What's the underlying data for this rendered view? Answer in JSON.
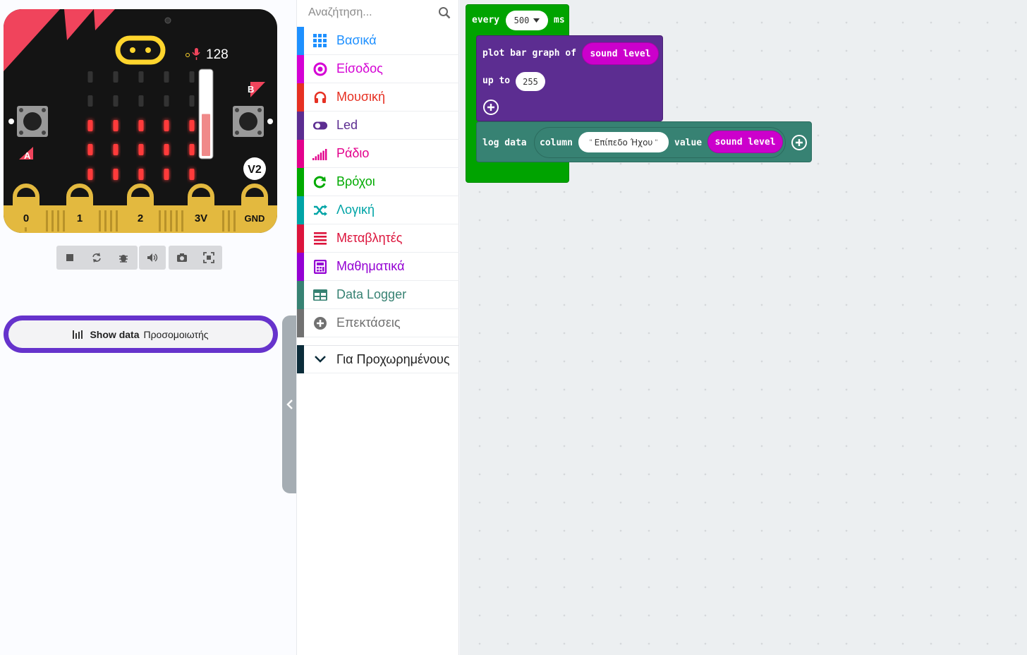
{
  "simulator": {
    "sound_value": "128",
    "sound_level_fraction": 0.5,
    "button_a": "A",
    "button_b": "B",
    "version_badge": "V2",
    "pins": [
      "0",
      "1",
      "2",
      "3V",
      "GND"
    ],
    "led_rows": [
      [
        0,
        0,
        0,
        0,
        0
      ],
      [
        0,
        0,
        0,
        0,
        0
      ],
      [
        1,
        1,
        1,
        1,
        1
      ],
      [
        1,
        1,
        1,
        1,
        1
      ],
      [
        1,
        1,
        1,
        1,
        1
      ]
    ],
    "toolbar": [
      "stop",
      "restart",
      "debug",
      "mute",
      "screenshot",
      "fullscreen"
    ]
  },
  "show_data": {
    "label_bold": "Show data",
    "label_rest": "Προσομοιωτής"
  },
  "toolbox": {
    "search_placeholder": "Αναζήτηση...",
    "categories": [
      {
        "label": "Βασικά",
        "color": "#1e90ff",
        "icon": "grid-icon"
      },
      {
        "label": "Είσοδος",
        "color": "#d400d4",
        "icon": "input-circle-icon"
      },
      {
        "label": "Μουσική",
        "color": "#e63022",
        "icon": "headphones-icon"
      },
      {
        "label": "Led",
        "color": "#5c2d91",
        "icon": "toggle-icon"
      },
      {
        "label": "Ράδιο",
        "color": "#e3008c",
        "icon": "signal-bars-icon"
      },
      {
        "label": "Βρόχοι",
        "color": "#00aa00",
        "icon": "refresh-icon"
      },
      {
        "label": "Λογική",
        "color": "#00a4a6",
        "icon": "shuffle-icon"
      },
      {
        "label": "Μεταβλητές",
        "color": "#dc143c",
        "icon": "list-lines-icon"
      },
      {
        "label": "Μαθηματικά",
        "color": "#9400d3",
        "icon": "calculator-icon"
      },
      {
        "label": "Data Logger",
        "color": "#378273",
        "icon": "table-icon"
      },
      {
        "label": "Επεκτάσεις",
        "color": "#717171",
        "icon": "plus-circle-icon"
      }
    ],
    "advanced": {
      "label": "Για Προχωρημένους",
      "color": "#0b2c3a"
    }
  },
  "blocks": {
    "every": {
      "keyword": "every",
      "value": "500",
      "unit": "ms",
      "color": "#00a300"
    },
    "plot": {
      "line1": "plot bar graph of",
      "arg": "sound level",
      "line2": "up to",
      "max": "255",
      "color": "#5c2d91"
    },
    "log": {
      "keyword": "log data",
      "column_kw": "column",
      "column_value": "Επίπεδο Ήχου",
      "value_kw": "value",
      "value_arg": "sound level",
      "color": "#378273"
    }
  }
}
